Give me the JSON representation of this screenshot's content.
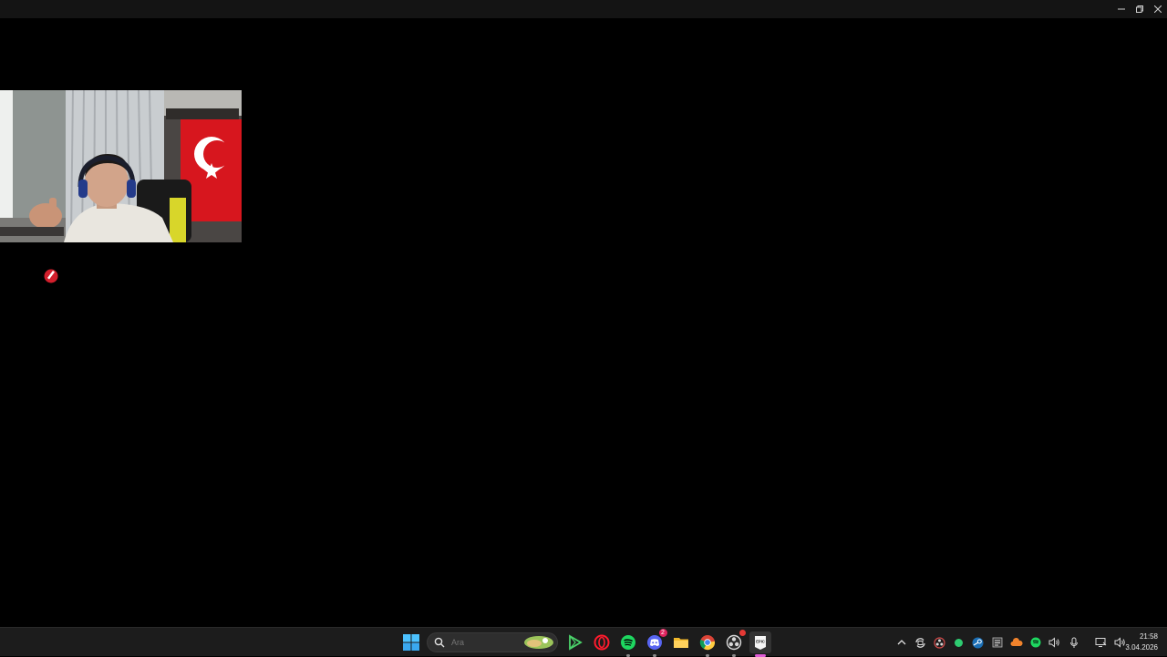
{
  "window": {
    "controls": {
      "minimize_icon": "minimize-icon",
      "restore_icon": "restore-icon",
      "close_icon": "close-icon"
    }
  },
  "webcam": {
    "description_icon": "webcam-feed"
  },
  "taskbar": {
    "search": {
      "placeholder": "Ara",
      "value": ""
    },
    "apps": [
      {
        "name": "start",
        "icon": "windows-start-icon"
      },
      {
        "name": "search",
        "icon": "search-icon"
      },
      {
        "name": "play",
        "icon": "play-store-icon"
      },
      {
        "name": "opera-gx",
        "icon": "opera-icon"
      },
      {
        "name": "spotify",
        "icon": "spotify-icon"
      },
      {
        "name": "discord",
        "icon": "discord-icon",
        "badge": "2"
      },
      {
        "name": "file-explorer",
        "icon": "folder-icon"
      },
      {
        "name": "chrome",
        "icon": "chrome-icon"
      },
      {
        "name": "obs",
        "icon": "obs-icon"
      },
      {
        "name": "epic-games",
        "icon": "epic-games-icon"
      }
    ],
    "epic_label": "EPIC"
  },
  "tray": {
    "icons": [
      "chevron-up-icon",
      "sync-icon",
      "obs-tray-icon",
      "green-status-icon",
      "steam-icon",
      "app-tray-icon",
      "cloud-icon",
      "spotify-tray-icon",
      "speaker-icon",
      "microphone-icon",
      "display-icon",
      "volume-icon"
    ]
  },
  "clock": {
    "time": "21:58",
    "date": "3.04.2026"
  },
  "colors": {
    "taskbar": "#1c1c1c",
    "accent": "#e05cd6",
    "spotify": "#1ed760",
    "discord": "#5865f2"
  }
}
